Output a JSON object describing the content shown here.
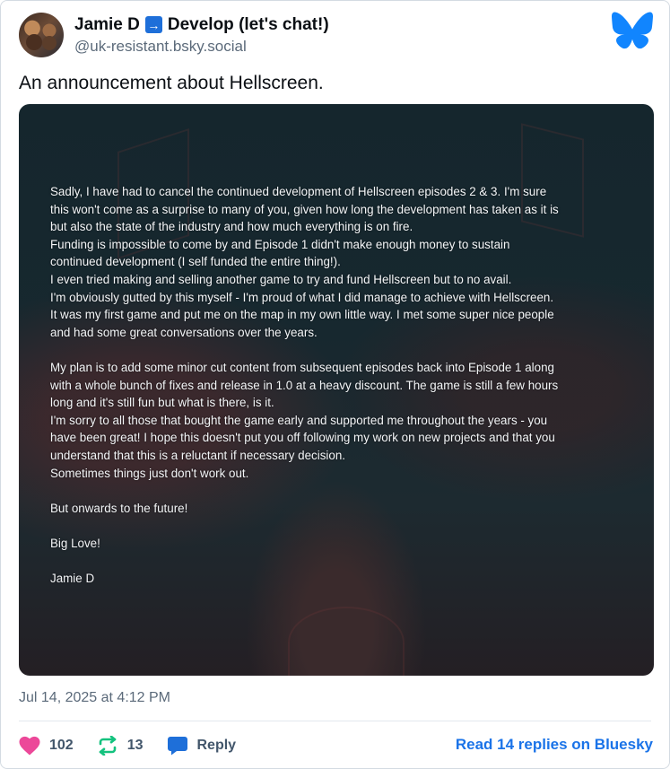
{
  "author": {
    "display_name_prefix": "Jamie D",
    "display_name_arrow": "→",
    "display_name_suffix": "Develop (let's chat!)",
    "handle": "@uk-resistant.bsky.social"
  },
  "post": {
    "text": "An announcement about Hellscreen.",
    "image_text": {
      "paragraph1": "Sadly, I have had to cancel the continued development of Hellscreen episodes 2 & 3. I'm sure\nthis won't come as a surprise to many of you, given how long the development has taken as it is\nbut also the state of the industry and how much everything is on fire.\nFunding is impossible to come by and Episode 1 didn't make enough money to sustain\ncontinued development (I self funded the entire thing!).\nI even tried making and selling another game to try and fund Hellscreen but to no avail.\nI'm obviously gutted by this myself - I'm proud of what I did manage to achieve with Hellscreen.\nIt was my first game and put me on the map in my own little way. I met some super nice people\nand had some great conversations over the years.",
      "paragraph2": "My plan is to add some minor cut content from subsequent episodes back into Episode 1 along\nwith a whole bunch of fixes and release in 1.0 at a heavy discount. The game is still a few hours\nlong and it's still fun but what is there, is it.\nI'm sorry to all those that bought the game early and supported me throughout the years - you\nhave been great! I hope this doesn't put you off following my work on new projects and that you\nunderstand that this is a reluctant if necessary decision.\nSometimes things just don't work out.",
      "paragraph3": "But onwards to the future!",
      "paragraph4": "Big Love!",
      "signature": "Jamie D"
    },
    "timestamp": "Jul 14, 2025 at 4:12 PM"
  },
  "actions": {
    "likes": "102",
    "reposts": "13",
    "reply_label": "Reply",
    "read_replies": "Read 14 replies on Bluesky"
  },
  "colors": {
    "like": "#ec4899",
    "repost": "#13c27e",
    "reply": "#1e6fd9",
    "link": "#1a73e8",
    "bluesky": "#1185fe"
  },
  "icons": [
    "avatar",
    "arrow-right-icon",
    "bluesky-butterfly-icon",
    "heart-icon",
    "repost-icon",
    "reply-icon"
  ]
}
